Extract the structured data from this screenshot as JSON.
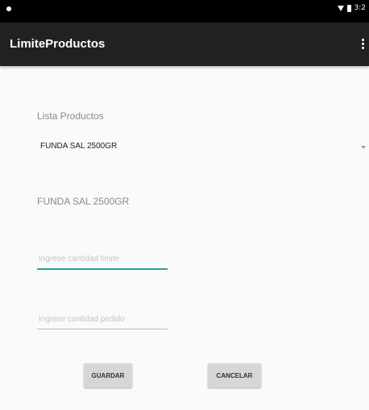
{
  "status_bar": {
    "time": "3:2"
  },
  "app_bar": {
    "title": "LimiteProductos"
  },
  "form": {
    "product_list_label": "Lista Productos",
    "product_spinner_value": "FUNDA SAL 2500GR",
    "selected_product_text": "FUNDA SAL 2500GR",
    "input_1_placeholder": "Ingrese cantidad limite",
    "input_2_placeholder": "Ingrese cantidad pedido"
  },
  "buttons": {
    "save_label": "GUARDAR",
    "cancel_label": "CANCELAR"
  },
  "colors": {
    "app_bar": "#212121",
    "status_bar": "#000000",
    "accent": "#26a69a",
    "background": "#fafafa"
  }
}
